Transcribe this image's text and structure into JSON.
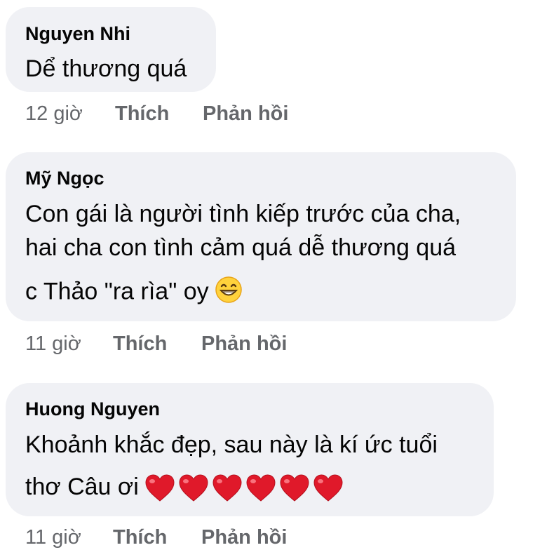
{
  "comments": [
    {
      "author": "Nguyen Nhi",
      "lines": [
        "Dể thương quá"
      ],
      "time": "12 giờ",
      "like_label": "Thích",
      "reply_label": "Phản hồi"
    },
    {
      "author": "Mỹ Ngọc",
      "lines": [
        "Con gái là người tình kiếp trước của cha,",
        "hai cha con tình cảm quá dễ thương quá",
        "c Thảo \"ra rìa\" oy"
      ],
      "emoji": "grinning-face-emoji",
      "time": "11 giờ",
      "like_label": "Thích",
      "reply_label": "Phản hồi"
    },
    {
      "author": "Huong Nguyen",
      "lines": [
        "Khoảnh khắc đẹp, sau này là kí ức tuổi",
        "thơ Câu ơi"
      ],
      "emoji": "red-heart-emoji",
      "emoji_count": 6,
      "time": "11 giờ",
      "like_label": "Thích",
      "reply_label": "Phản hồi"
    }
  ],
  "colors": {
    "bubble": "#f0f1f5",
    "text": "#050505",
    "meta": "#65676b",
    "heart": "#e0192a"
  }
}
